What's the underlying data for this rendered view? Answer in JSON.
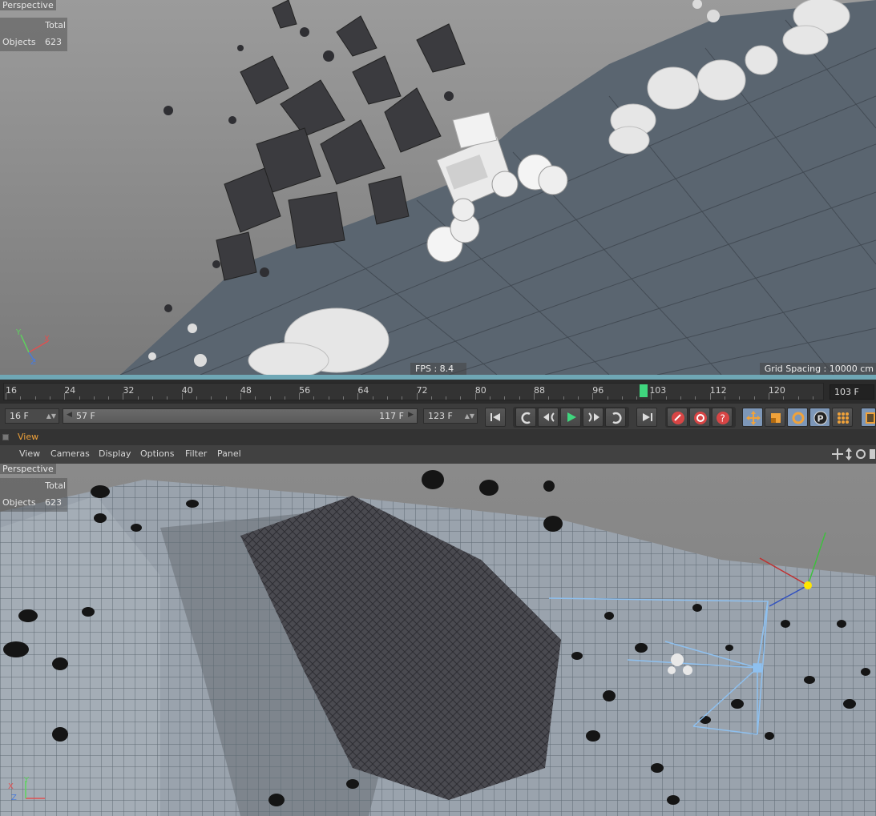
{
  "viewport_top": {
    "label": "Perspective",
    "hud": {
      "total_label": "Total",
      "objects_label": "Objects",
      "objects_count": "623"
    },
    "fps": "FPS : 8.4",
    "grid_spacing": "Grid Spacing : 10000 cm",
    "axes": {
      "x": "X",
      "y": "Y",
      "z": "Z"
    }
  },
  "timeline": {
    "ticks": [
      "16",
      "24",
      "32",
      "40",
      "48",
      "56",
      "64",
      "72",
      "80",
      "88",
      "96",
      "103",
      "112",
      "120"
    ],
    "current_frame": 103,
    "current_frame_field": "103 F",
    "first_frame": 16,
    "last_frame": 123
  },
  "transport": {
    "start_field": "16 F",
    "range_start": "57 F",
    "range_end": "117 F",
    "end_field": "123 F",
    "icons": [
      "goto-start-icon",
      "prev-key-icon",
      "step-back-icon",
      "play-icon",
      "step-forward-icon",
      "next-key-icon",
      "goto-end-icon",
      "record-icon",
      "autokey-icon",
      "help-key-icon",
      "move-key-icon",
      "scale-key-icon",
      "rotate-key-icon",
      "param-key-icon",
      "pla-key-icon",
      "timeline-window-icon"
    ],
    "colors": {
      "play": "#3fd67e",
      "record": "#d84545",
      "accent": "#f0a23a"
    }
  },
  "panel": {
    "title": "View",
    "menu": [
      "View",
      "Cameras",
      "Display",
      "Options",
      "Filter",
      "Panel"
    ]
  },
  "viewport_bottom": {
    "label": "Perspective",
    "hud": {
      "total_label": "Total",
      "objects_label": "Objects",
      "objects_count": "623"
    },
    "axes": {
      "x": "X",
      "y": "Y",
      "z": "Z"
    }
  }
}
